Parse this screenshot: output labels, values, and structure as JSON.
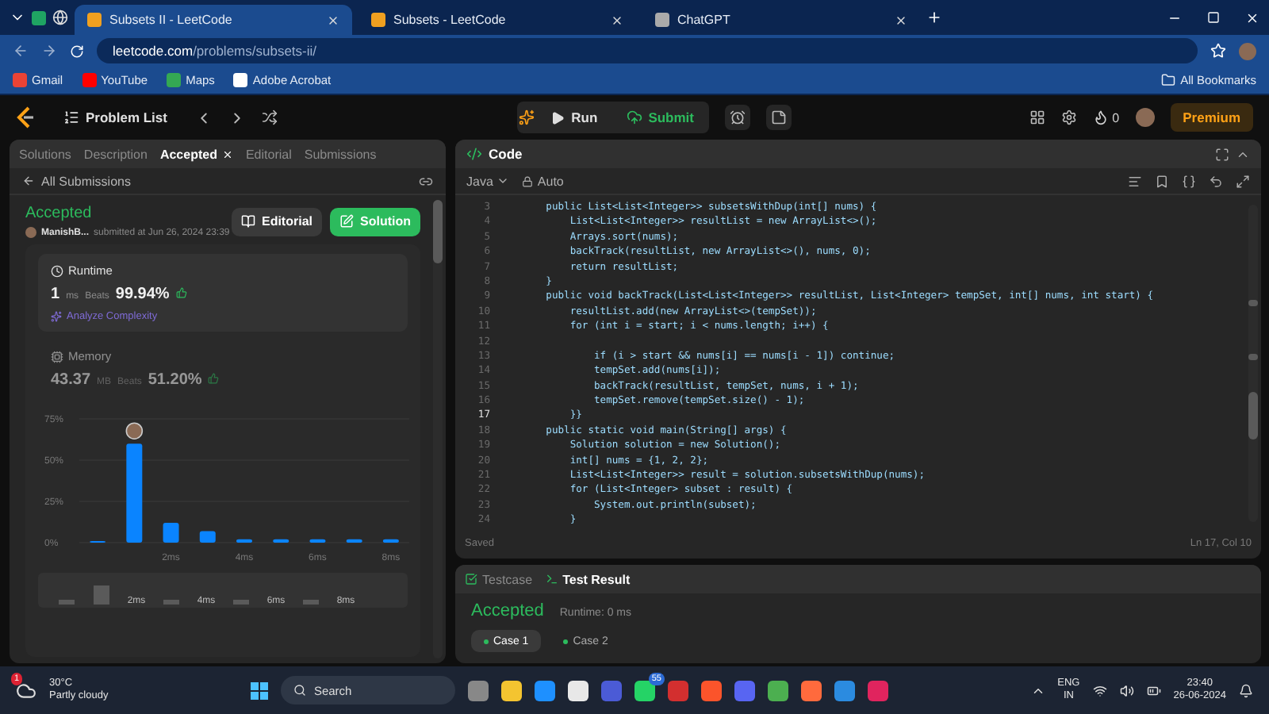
{
  "browser": {
    "tabs": [
      {
        "label": "Subsets II - LeetCode",
        "selected": true
      },
      {
        "label": "Subsets - LeetCode",
        "selected": false
      },
      {
        "label": "ChatGPT",
        "selected": false
      }
    ],
    "address": {
      "host": "leetcode.com",
      "path": "/problems/subsets-ii/"
    },
    "bookmarks": [
      "Gmail",
      "YouTube",
      "Maps",
      "Adobe Acrobat"
    ],
    "all_bookmarks": "All Bookmarks"
  },
  "nav": {
    "problem_list": "Problem List",
    "run": "Run",
    "submit": "Submit",
    "streak": "0",
    "premium": "Premium"
  },
  "left_panel": {
    "tabs": [
      {
        "label": "Solutions",
        "selected": false
      },
      {
        "label": "Description",
        "selected": false
      },
      {
        "label": "Accepted",
        "selected": true
      },
      {
        "label": "Editorial",
        "selected": false
      },
      {
        "label": "Submissions",
        "selected": false
      }
    ],
    "back_link": "All Submissions",
    "status": "Accepted",
    "user": "ManishB...",
    "submitted": "submitted at Jun 26, 2024 23:39",
    "editorial_button": "Editorial",
    "solution_button": "Solution",
    "stats": [
      {
        "title": "Runtime",
        "value": "1",
        "unit": "ms",
        "beats_label": "Beats",
        "beats": "99.94%",
        "selected": true,
        "link": "Analyze Complexity"
      },
      {
        "title": "Memory",
        "value": "43.37",
        "unit": "MB",
        "beats_label": "Beats",
        "beats": "51.20%",
        "selected": false
      }
    ],
    "chart_data": {
      "type": "bar",
      "categories": [
        null,
        null,
        "2ms",
        null,
        "4ms",
        null,
        "6ms",
        null,
        "8ms"
      ],
      "values": [
        1,
        60,
        12,
        7,
        2,
        2,
        2,
        2,
        2
      ],
      "ylim": [
        0,
        75
      ],
      "yticks": [
        {
          "value": 0,
          "label": "0%"
        },
        {
          "value": 25,
          "label": "25%"
        },
        {
          "value": 50,
          "label": "50%"
        },
        {
          "value": 75,
          "label": "75%"
        }
      ]
    },
    "overview_labels": [
      "2ms",
      "4ms",
      "6ms",
      "8ms"
    ]
  },
  "code_panel": {
    "title": "Code",
    "language": "Java",
    "mode": "Auto",
    "lines": [
      {
        "n": "3",
        "current": false,
        "text": "    public List<List<Integer>> subsetsWithDup(int[] nums) {"
      },
      {
        "n": "4",
        "current": false,
        "text": "        List<List<Integer>> resultList = new ArrayList<>();"
      },
      {
        "n": "5",
        "current": false,
        "text": "        Arrays.sort(nums);"
      },
      {
        "n": "6",
        "current": false,
        "text": "        backTrack(resultList, new ArrayList<>(), nums, 0);"
      },
      {
        "n": "7",
        "current": false,
        "text": "        return resultList;"
      },
      {
        "n": "8",
        "current": false,
        "text": "    }"
      },
      {
        "n": "9",
        "current": false,
        "text": "    public void backTrack(List<List<Integer>> resultList, List<Integer> tempSet, int[] nums, int start) {"
      },
      {
        "n": "10",
        "current": false,
        "text": "        resultList.add(new ArrayList<>(tempSet));"
      },
      {
        "n": "11",
        "current": false,
        "text": "        for (int i = start; i < nums.length; i++) {"
      },
      {
        "n": "12",
        "current": false
      },
      {
        "n": "13",
        "current": false,
        "text": "            if (i > start && nums[i] == nums[i - 1]) continue;"
      },
      {
        "n": "14",
        "current": false,
        "text": "            tempSet.add(nums[i]);"
      },
      {
        "n": "15",
        "current": false,
        "text": "            backTrack(resultList, tempSet, nums, i + 1);"
      },
      {
        "n": "16",
        "current": false,
        "text": "            tempSet.remove(tempSet.size() - 1);"
      },
      {
        "n": "17",
        "current": true,
        "text": "        }}"
      },
      {
        "n": "18",
        "current": false,
        "text": "    public static void main(String[] args) {"
      },
      {
        "n": "19",
        "current": false,
        "text": "        Solution solution = new Solution();"
      },
      {
        "n": "20",
        "current": false,
        "text": "        int[] nums = {1, 2, 2};"
      },
      {
        "n": "21",
        "current": false,
        "text": "        List<List<Integer>> result = solution.subsetsWithDup(nums);"
      },
      {
        "n": "22",
        "current": false,
        "text": "        for (List<Integer> subset : result) {"
      },
      {
        "n": "23",
        "current": false,
        "text": "            System.out.println(subset);"
      },
      {
        "n": "24",
        "current": false,
        "text": "        }"
      }
    ],
    "saved": "Saved",
    "cursor": "Ln 17, Col 10"
  },
  "test_panel": {
    "tabs": [
      {
        "label": "Testcase",
        "selected": false
      },
      {
        "label": "Test Result",
        "selected": true
      }
    ],
    "status": "Accepted",
    "runtime": "Runtime: 0 ms",
    "cases": [
      {
        "label": "Case 1",
        "selected": true
      },
      {
        "label": "Case 2",
        "selected": false
      }
    ]
  },
  "taskbar": {
    "temperature": "30°C",
    "weather": "Partly cloudy",
    "weather_badge": "1",
    "search": "Search",
    "chat_badge": "55",
    "language": "ENG",
    "region": "IN",
    "time": "23:40",
    "date": "26-06-2024"
  }
}
